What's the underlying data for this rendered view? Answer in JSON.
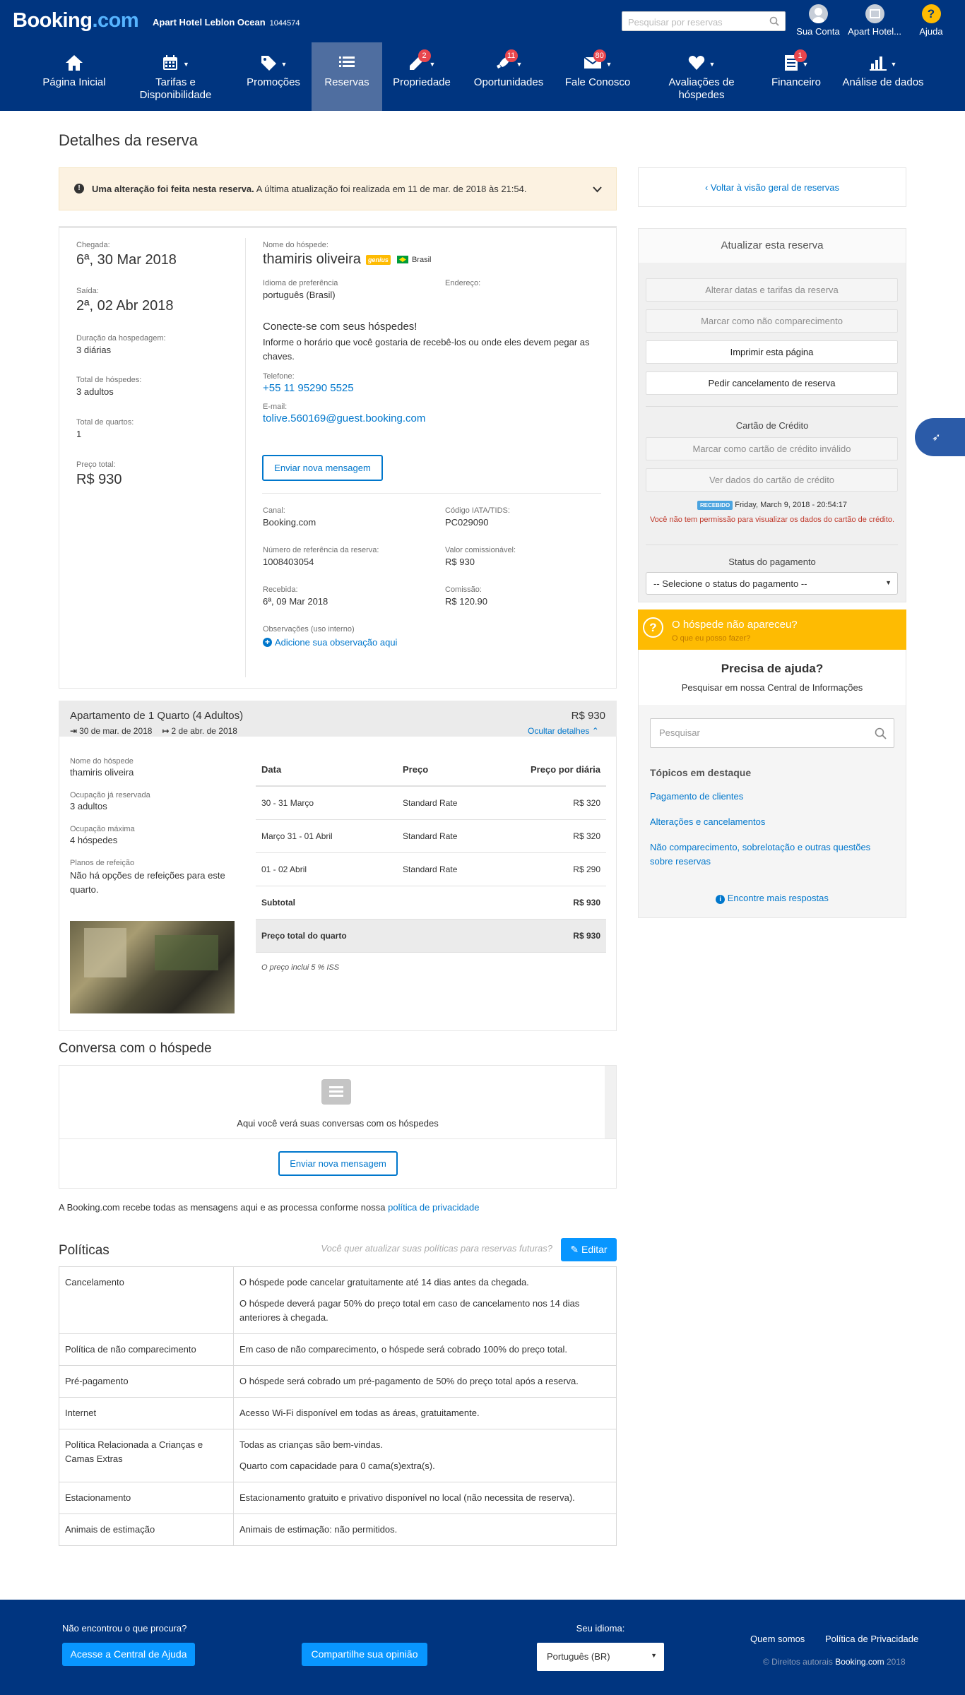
{
  "topbar": {
    "logo_main": "Booking",
    "logo_dot": ".com",
    "hotel_name": "Apart Hotel Leblon Ocean",
    "hotel_id": "1044574",
    "search_placeholder": "Pesquisar por reservas",
    "account": "Sua Conta",
    "property": "Apart Hotel...",
    "help": "Ajuda"
  },
  "nav": [
    {
      "label": "Página Inicial",
      "icon": "home-icon"
    },
    {
      "label": "Tarifas e Disponibilidade",
      "icon": "calendar-icon"
    },
    {
      "label": "Promoções",
      "icon": "tag-icon"
    },
    {
      "label": "Reservas",
      "icon": "list-icon"
    },
    {
      "label": "Propriedade",
      "icon": "pencil-icon",
      "badge": "2"
    },
    {
      "label": "Oportunidades",
      "icon": "rocket-icon",
      "badge": "11"
    },
    {
      "label": "Fale Conosco",
      "icon": "mail-icon",
      "badge": "80"
    },
    {
      "label": "Avaliações de hóspedes",
      "icon": "heart-icon"
    },
    {
      "label": "Financeiro",
      "icon": "document-icon",
      "badge": "1"
    },
    {
      "label": "Análise de dados",
      "icon": "bar-chart-icon"
    }
  ],
  "page": {
    "title": "Detalhes da reserva"
  },
  "alert": {
    "bold": "Uma alteração foi feita nesta reserva.",
    "text": "A última atualização foi realizada em 11 de mar. de 2018 às 21:54."
  },
  "stay": {
    "checkin_label": "Chegada:",
    "checkin": "6ª, 30 Mar 2018",
    "checkout_label": "Saída:",
    "checkout": "2ª, 02 Abr 2018",
    "duration_label": "Duração da hospedagem:",
    "duration": "3 diárias",
    "guests_label": "Total de hóspedes:",
    "guests": "3 adultos",
    "rooms_label": "Total de quartos:",
    "rooms": "1",
    "price_label": "Preço total:",
    "price": "R$ 930"
  },
  "guest": {
    "name_label": "Nome do hóspede:",
    "name": "thamiris oliveira",
    "genius": "genius",
    "country": "Brasil",
    "lang_label": "Idioma de preferência",
    "lang": "português (Brasil)",
    "address_label": "Endereço:",
    "connect_title": "Conecte-se com seus hóspedes!",
    "connect_text": "Informe o horário que você gostaria de recebê-los ou onde eles devem pegar as chaves.",
    "phone_label": "Telefone:",
    "phone": "+55 11 95290 5525",
    "email_label": "E-mail:",
    "email": "tolive.560169@guest.booking.com",
    "send_btn": "Enviar nova mensagem"
  },
  "booking": {
    "channel_label": "Canal:",
    "channel": "Booking.com",
    "iata_label": "Código IATA/TIDS:",
    "iata": "PC029090",
    "ref_label": "Número de referência da reserva:",
    "ref": "1008403054",
    "commissionable_label": "Valor comissionável:",
    "commissionable": "R$ 930",
    "received_label": "Recebida:",
    "received": "6ª, 09 Mar 2018",
    "commission_label": "Comissão:",
    "commission": "R$ 120.90",
    "notes_label": "Observações (uso interno)",
    "notes_link": "Adicione sua observação aqui"
  },
  "room": {
    "title": "Apartamento de 1 Quarto (4 Adultos)",
    "price": "R$ 930",
    "from": "30 de mar. de 2018",
    "to": "2 de abr. de 2018",
    "hide": "Ocultar detalhes",
    "guest_label": "Nome do hóspede",
    "guest": "thamiris oliveira",
    "occ_label": "Ocupação já reservada",
    "occ": "3 adultos",
    "max_label": "Ocupação máxima",
    "max": "4 hóspedes",
    "meal_label": "Planos de refeição",
    "meal": "Não há opções de refeições para este quarto.",
    "cols": [
      "Data",
      "Preço",
      "Preço por diária"
    ],
    "rows": [
      [
        "30 - 31 Março",
        "Standard Rate",
        "R$ 320"
      ],
      [
        "Março 31 - 01 Abril",
        "Standard Rate",
        "R$ 320"
      ],
      [
        "01 - 02 Abril",
        "Standard Rate",
        "R$ 290"
      ]
    ],
    "subtotal_label": "Subtotal",
    "subtotal": "R$ 930",
    "total_label": "Preço total do quarto",
    "total": "R$ 930",
    "tax_note": "O preço inclui 5 % ISS"
  },
  "conversation": {
    "title": "Conversa com o hóspede",
    "empty": "Aqui você verá suas conversas com os hóspedes",
    "send_btn": "Enviar nova mensagem",
    "privacy_text": "A Booking.com recebe todas as mensagens aqui e as processa conforme nossa",
    "privacy_link": "política de privacidade"
  },
  "policies": {
    "title": "Políticas",
    "hint": "Você quer atualizar suas políticas para reservas futuras?",
    "edit": "Editar",
    "rows": [
      {
        "name": "Cancelamento",
        "lines": [
          "O hóspede pode cancelar gratuitamente até 14 dias antes da chegada.",
          "O hóspede deverá pagar 50% do preço total em caso de cancelamento nos 14 dias anteriores à chegada."
        ]
      },
      {
        "name": "Política de não comparecimento",
        "lines": [
          "Em caso de não comparecimento, o hóspede será cobrado 100% do preço total."
        ]
      },
      {
        "name": "Pré-pagamento",
        "lines": [
          "O hóspede será cobrado um pré-pagamento de 50% do preço total após a reserva."
        ]
      },
      {
        "name": "Internet",
        "lines": [
          "Acesso Wi-Fi disponível em todas as áreas, gratuitamente."
        ]
      },
      {
        "name": "Política Relacionada a Crianças e Camas Extras",
        "lines": [
          "Todas as crianças são bem-vindas.",
          "Quarto com capacidade para 0 cama(s)extra(s)."
        ]
      },
      {
        "name": "Estacionamento",
        "lines": [
          "Estacionamento gratuito e privativo disponível no local (não necessita de reserva)."
        ]
      },
      {
        "name": "Animais de estimação",
        "lines": [
          "Animais de estimação: não permitidos."
        ]
      }
    ]
  },
  "sidebar": {
    "back": "Voltar à visão geral de reservas",
    "update_title": "Atualizar esta reserva",
    "change_dates": "Alterar datas e tarifas da reserva",
    "no_show": "Marcar como não comparecimento",
    "print": "Imprimir esta página",
    "cancel": "Pedir cancelamento de reserva",
    "card_title": "Cartão de Crédito",
    "card_invalid": "Marcar como cartão de crédito inválido",
    "card_view": "Ver dados do cartão de crédito",
    "received_badge": "RECEBIDO",
    "received_date": "Friday, March 9, 2018 - 20:54:17",
    "no_permission": "Você não tem permissão para visualizar os dados do cartão de crédito.",
    "payment_title": "Status do pagamento",
    "payment_select": "-- Selecione o status do pagamento --"
  },
  "noshow_box": {
    "title": "O hóspede não apareceu?",
    "sub": "O que eu posso fazer?"
  },
  "help": {
    "title": "Precisa de ajuda?",
    "sub": "Pesquisar em nossa Central de Informações",
    "search_placeholder": "Pesquisar",
    "topics_title": "Tópicos em destaque",
    "topics": [
      "Pagamento de clientes",
      "Alterações e cancelamentos",
      "Não comparecimento, sobrelotação e outras questões sobre reservas"
    ],
    "more": "Encontre mais respostas"
  },
  "footer": {
    "not_found": "Não encontrou o que procura?",
    "help_btn": "Acesse a Central de Ajuda",
    "feedback_btn": "Compartilhe sua opinião",
    "lang_label": "Seu idioma:",
    "lang": "Português (BR)",
    "about": "Quem somos",
    "privacy": "Política de Privacidade",
    "copyright": "© Direitos autorais",
    "brand": "Booking.com",
    "year": "2018"
  },
  "colors": {
    "brand": "#003580",
    "accent": "#0077cc",
    "alert_bg": "#fcf2e1",
    "warning": "#febb02"
  }
}
